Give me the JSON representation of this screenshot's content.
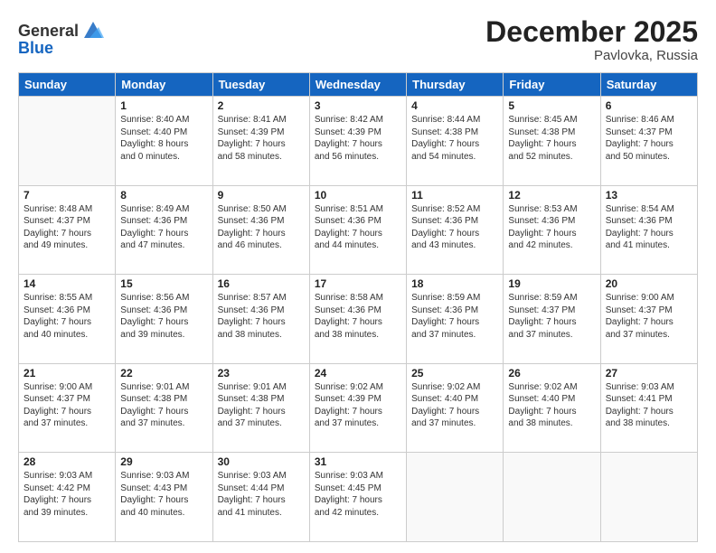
{
  "header": {
    "logo_general": "General",
    "logo_blue": "Blue",
    "month_title": "December 2025",
    "location": "Pavlovka, Russia"
  },
  "days_of_week": [
    "Sunday",
    "Monday",
    "Tuesday",
    "Wednesday",
    "Thursday",
    "Friday",
    "Saturday"
  ],
  "weeks": [
    [
      {
        "day": "",
        "content": ""
      },
      {
        "day": "1",
        "content": "Sunrise: 8:40 AM\nSunset: 4:40 PM\nDaylight: 8 hours\nand 0 minutes."
      },
      {
        "day": "2",
        "content": "Sunrise: 8:41 AM\nSunset: 4:39 PM\nDaylight: 7 hours\nand 58 minutes."
      },
      {
        "day": "3",
        "content": "Sunrise: 8:42 AM\nSunset: 4:39 PM\nDaylight: 7 hours\nand 56 minutes."
      },
      {
        "day": "4",
        "content": "Sunrise: 8:44 AM\nSunset: 4:38 PM\nDaylight: 7 hours\nand 54 minutes."
      },
      {
        "day": "5",
        "content": "Sunrise: 8:45 AM\nSunset: 4:38 PM\nDaylight: 7 hours\nand 52 minutes."
      },
      {
        "day": "6",
        "content": "Sunrise: 8:46 AM\nSunset: 4:37 PM\nDaylight: 7 hours\nand 50 minutes."
      }
    ],
    [
      {
        "day": "7",
        "content": "Sunrise: 8:48 AM\nSunset: 4:37 PM\nDaylight: 7 hours\nand 49 minutes."
      },
      {
        "day": "8",
        "content": "Sunrise: 8:49 AM\nSunset: 4:36 PM\nDaylight: 7 hours\nand 47 minutes."
      },
      {
        "day": "9",
        "content": "Sunrise: 8:50 AM\nSunset: 4:36 PM\nDaylight: 7 hours\nand 46 minutes."
      },
      {
        "day": "10",
        "content": "Sunrise: 8:51 AM\nSunset: 4:36 PM\nDaylight: 7 hours\nand 44 minutes."
      },
      {
        "day": "11",
        "content": "Sunrise: 8:52 AM\nSunset: 4:36 PM\nDaylight: 7 hours\nand 43 minutes."
      },
      {
        "day": "12",
        "content": "Sunrise: 8:53 AM\nSunset: 4:36 PM\nDaylight: 7 hours\nand 42 minutes."
      },
      {
        "day": "13",
        "content": "Sunrise: 8:54 AM\nSunset: 4:36 PM\nDaylight: 7 hours\nand 41 minutes."
      }
    ],
    [
      {
        "day": "14",
        "content": "Sunrise: 8:55 AM\nSunset: 4:36 PM\nDaylight: 7 hours\nand 40 minutes."
      },
      {
        "day": "15",
        "content": "Sunrise: 8:56 AM\nSunset: 4:36 PM\nDaylight: 7 hours\nand 39 minutes."
      },
      {
        "day": "16",
        "content": "Sunrise: 8:57 AM\nSunset: 4:36 PM\nDaylight: 7 hours\nand 38 minutes."
      },
      {
        "day": "17",
        "content": "Sunrise: 8:58 AM\nSunset: 4:36 PM\nDaylight: 7 hours\nand 38 minutes."
      },
      {
        "day": "18",
        "content": "Sunrise: 8:59 AM\nSunset: 4:36 PM\nDaylight: 7 hours\nand 37 minutes."
      },
      {
        "day": "19",
        "content": "Sunrise: 8:59 AM\nSunset: 4:37 PM\nDaylight: 7 hours\nand 37 minutes."
      },
      {
        "day": "20",
        "content": "Sunrise: 9:00 AM\nSunset: 4:37 PM\nDaylight: 7 hours\nand 37 minutes."
      }
    ],
    [
      {
        "day": "21",
        "content": "Sunrise: 9:00 AM\nSunset: 4:37 PM\nDaylight: 7 hours\nand 37 minutes."
      },
      {
        "day": "22",
        "content": "Sunrise: 9:01 AM\nSunset: 4:38 PM\nDaylight: 7 hours\nand 37 minutes."
      },
      {
        "day": "23",
        "content": "Sunrise: 9:01 AM\nSunset: 4:38 PM\nDaylight: 7 hours\nand 37 minutes."
      },
      {
        "day": "24",
        "content": "Sunrise: 9:02 AM\nSunset: 4:39 PM\nDaylight: 7 hours\nand 37 minutes."
      },
      {
        "day": "25",
        "content": "Sunrise: 9:02 AM\nSunset: 4:40 PM\nDaylight: 7 hours\nand 37 minutes."
      },
      {
        "day": "26",
        "content": "Sunrise: 9:02 AM\nSunset: 4:40 PM\nDaylight: 7 hours\nand 38 minutes."
      },
      {
        "day": "27",
        "content": "Sunrise: 9:03 AM\nSunset: 4:41 PM\nDaylight: 7 hours\nand 38 minutes."
      }
    ],
    [
      {
        "day": "28",
        "content": "Sunrise: 9:03 AM\nSunset: 4:42 PM\nDaylight: 7 hours\nand 39 minutes."
      },
      {
        "day": "29",
        "content": "Sunrise: 9:03 AM\nSunset: 4:43 PM\nDaylight: 7 hours\nand 40 minutes."
      },
      {
        "day": "30",
        "content": "Sunrise: 9:03 AM\nSunset: 4:44 PM\nDaylight: 7 hours\nand 41 minutes."
      },
      {
        "day": "31",
        "content": "Sunrise: 9:03 AM\nSunset: 4:45 PM\nDaylight: 7 hours\nand 42 minutes."
      },
      {
        "day": "",
        "content": ""
      },
      {
        "day": "",
        "content": ""
      },
      {
        "day": "",
        "content": ""
      }
    ]
  ]
}
